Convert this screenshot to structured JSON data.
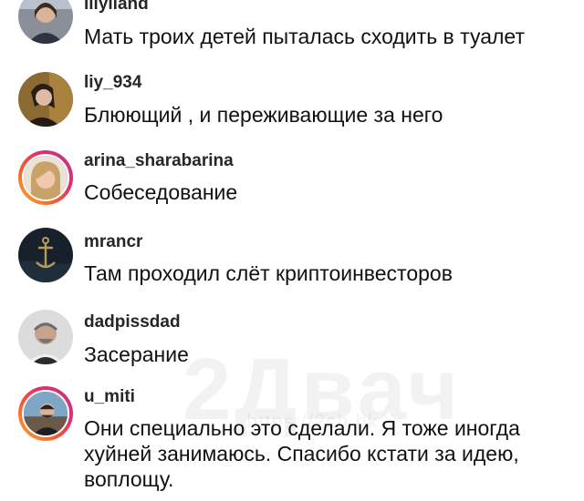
{
  "watermark": {
    "logo": "2Двач",
    "url": "https://2ch.hk"
  },
  "comments": [
    {
      "username": "lilylland",
      "text": "Мать троих детей пыталась сходить в туалет",
      "avatar_ring": false
    },
    {
      "username": "liy_934",
      "text": "Блюющий , и переживающие за него",
      "avatar_ring": false
    },
    {
      "username": "arina_sharabarina",
      "text": "Собеседование",
      "avatar_ring": true
    },
    {
      "username": "mrancr",
      "text": "Там проходил слёт криптоинвесторов",
      "avatar_ring": false
    },
    {
      "username": "dadpissdad",
      "text": "Засерание",
      "avatar_ring": false
    },
    {
      "username": "u_miti",
      "text": "Они специально это сделали. Я тоже иногда хуйней занимаюсь. Спасибо кстати за идею, воплощу.",
      "avatar_ring": true
    }
  ],
  "colors": {
    "story_ring_start": "#f9b233",
    "story_ring_end": "#c13584",
    "username": "#262626"
  }
}
